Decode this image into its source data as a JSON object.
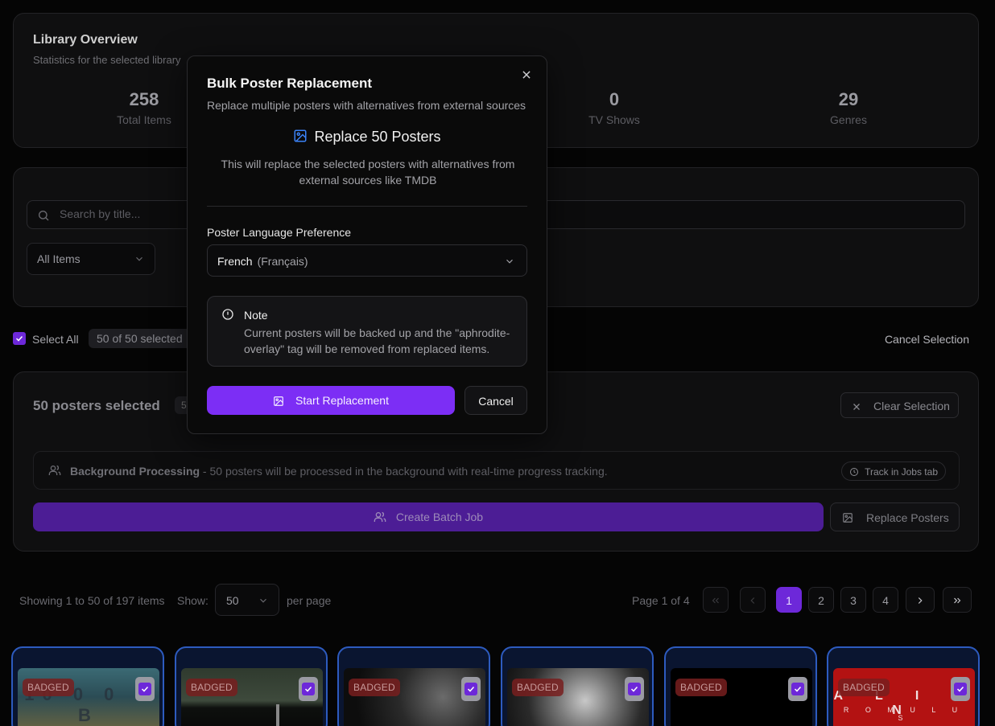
{
  "overview": {
    "title": "Library Overview",
    "subtitle": "Statistics for the selected library",
    "stats": [
      {
        "value": "258",
        "label": "Total Items"
      },
      {
        "value": "0",
        "label": "TV Shows"
      },
      {
        "value": "29",
        "label": "Genres"
      }
    ]
  },
  "filters": {
    "search_placeholder": "Search by title...",
    "type_select_value": "All Items"
  },
  "selection_bar": {
    "select_all_label": "Select All",
    "selected_count": "50 of 50 selected",
    "cancel_selection": "Cancel Selection"
  },
  "selection_panel": {
    "title": "50 posters selected",
    "badge": "5",
    "clear_selection": "Clear Selection",
    "bg_title": "Background Processing",
    "bg_text": " - 50 posters will be processed in the background with real-time progress tracking.",
    "track_label": "Track in Jobs tab",
    "create_batch": "Create Batch Job",
    "replace_posters": "Replace Posters"
  },
  "pagination": {
    "showing": "Showing 1 to 50 of 197 items",
    "show_label": "Show:",
    "per_page_value": "50",
    "per_page_label": "per page",
    "page_info": "Page 1 of 4",
    "pages": [
      "1",
      "2",
      "3",
      "4"
    ],
    "active_page": "1"
  },
  "posters": [
    {
      "badge": "BADGED",
      "title_text": "10 0 0 0 B"
    },
    {
      "badge": "BADGED",
      "title_text": ""
    },
    {
      "badge": "BADGED",
      "title_text": ""
    },
    {
      "badge": "BADGED",
      "title_text": ""
    },
    {
      "badge": "BADGED",
      "title_text": ""
    },
    {
      "badge": "BADGED",
      "title_text": "A L I E N",
      "subtitle_text": "R O M U L U S"
    }
  ],
  "modal": {
    "title": "Bulk Poster Replacement",
    "description": "Replace multiple posters with alternatives from external sources",
    "replace_heading": "Replace 50 Posters",
    "replace_desc": "This will replace the selected posters with alternatives from external sources like TMDB",
    "lang_label": "Poster Language Preference",
    "lang_value": "French",
    "lang_native": "(Français)",
    "note_title": "Note",
    "note_text": "Current posters will be backed up and the \"aphrodite-overlay\" tag will be removed from replaced items.",
    "start_button": "Start Replacement",
    "cancel_button": "Cancel"
  },
  "colors": {
    "accent": "#7c2ef5",
    "accent_dark": "#4c1d95",
    "poster_border": "#2d5bbf",
    "badge_bg": "#781e1e",
    "icon_blue": "#3b82f6"
  }
}
